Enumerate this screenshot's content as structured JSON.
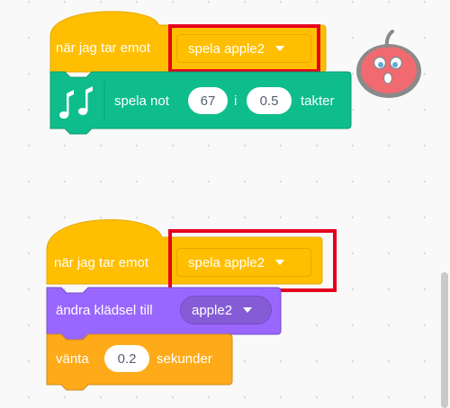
{
  "script1": {
    "hat_label": "när jag tar emot",
    "hat_dropdown": "spela apple2",
    "music_label": "spela not",
    "music_note": "67",
    "music_in": "i",
    "music_beats": "0.5",
    "music_unit": "takter"
  },
  "script2": {
    "hat_label": "när jag tar emot",
    "hat_dropdown": "spela apple2",
    "looks_label": "ändra klädsel till",
    "costume_dropdown": "apple2",
    "wait_label": "vänta",
    "wait_value": "0.2",
    "wait_unit": "sekunder"
  },
  "sprite": {
    "name": "apple-sprite-icon"
  },
  "colors": {
    "events": "#ffbf00",
    "events_dark": "#e6a800",
    "music": "#0fbd8c",
    "music_dark": "#0b9a72",
    "looks": "#9966ff",
    "looks_dark": "#774dcb",
    "control": "#ffab19",
    "control_dark": "#cf8b17",
    "highlight": "#e6001c"
  }
}
